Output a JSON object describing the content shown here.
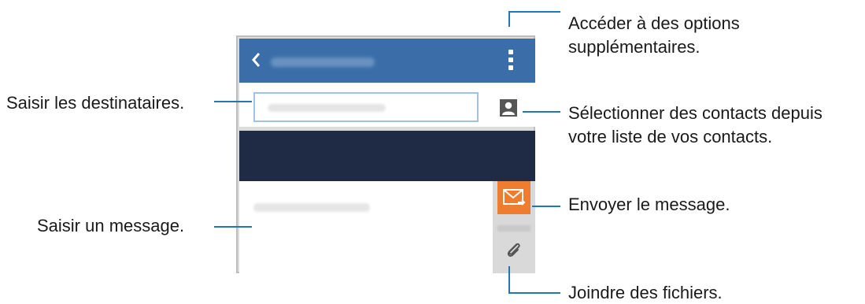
{
  "callouts": {
    "more_options_line1": "Accéder à des options",
    "more_options_line2": "supplémentaires.",
    "contacts_line1": "Sélectionner des contacts depuis",
    "contacts_line2": "votre liste de vos contacts.",
    "send": "Envoyer le message.",
    "attach": "Joindre des fichiers.",
    "recipients": "Saisir les destinataires.",
    "message": "Saisir un message."
  },
  "colors": {
    "appbar": "#3b6ea8",
    "dark_band": "#1f2a44",
    "send_button": "#ef7d2f",
    "callout_line": "#2377b0"
  },
  "icons": [
    "back-icon",
    "more-options-icon",
    "contact-icon",
    "send-icon",
    "attach-icon"
  ]
}
